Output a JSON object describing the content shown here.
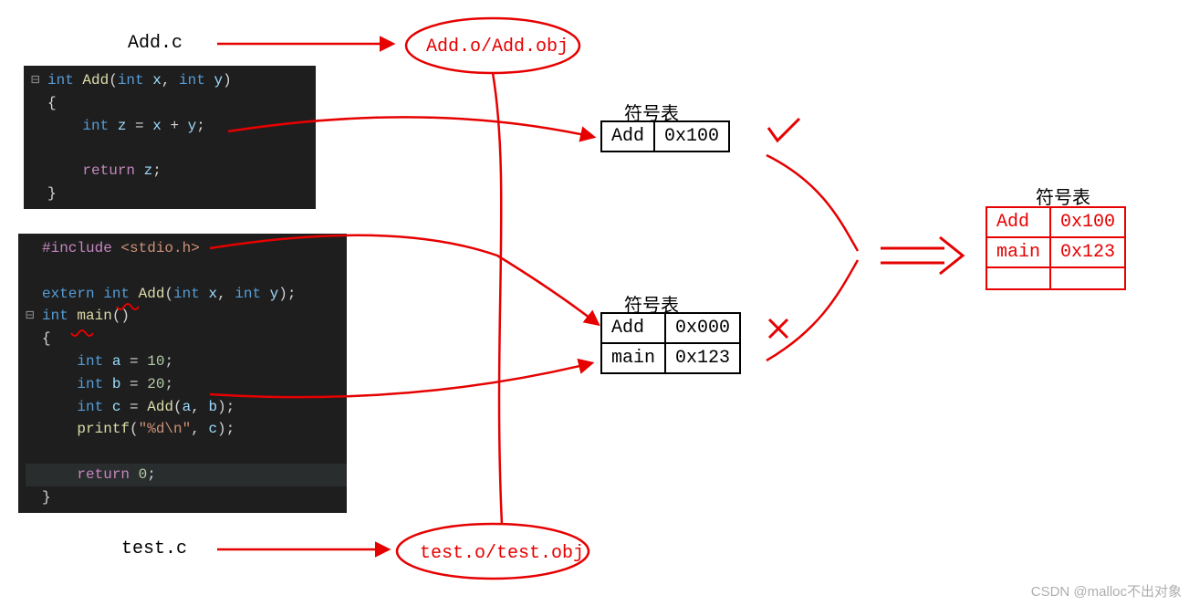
{
  "labels": {
    "add_c": "Add.c",
    "test_c": "test.c",
    "add_obj": "Add.o/Add.obj",
    "test_obj": "test.o/test.obj"
  },
  "sym_title": "符号表",
  "tables": {
    "add": {
      "rows": [
        [
          "Add",
          "0x100"
        ]
      ]
    },
    "test": {
      "rows": [
        [
          "Add",
          "0x000"
        ],
        [
          "main",
          "0x123"
        ]
      ]
    },
    "merged": {
      "rows": [
        [
          "Add",
          "0x100"
        ],
        [
          "main",
          "0x123"
        ]
      ]
    }
  },
  "code_add": {
    "lines": [
      {
        "fold": "⊟",
        "tok": [
          [
            "kw-blue",
            "int "
          ],
          [
            "kw-yellow",
            "Add"
          ],
          [
            "kw-white",
            "("
          ],
          [
            "kw-blue",
            "int "
          ],
          [
            "kw-grey",
            "x"
          ],
          [
            "kw-white",
            ", "
          ],
          [
            "kw-blue",
            "int "
          ],
          [
            "kw-grey",
            "y"
          ],
          [
            "kw-white",
            ")"
          ]
        ]
      },
      {
        "fold": " ",
        "tok": [
          [
            "kw-white",
            "{"
          ]
        ]
      },
      {
        "fold": " ",
        "tok": [
          [
            "kw-white",
            "    "
          ],
          [
            "kw-blue",
            "int "
          ],
          [
            "kw-grey",
            "z"
          ],
          [
            "kw-white",
            " = "
          ],
          [
            "kw-grey",
            "x"
          ],
          [
            "kw-white",
            " + "
          ],
          [
            "kw-grey",
            "y"
          ],
          [
            "kw-white",
            ";"
          ]
        ]
      },
      {
        "fold": " ",
        "tok": [
          [
            "kw-white",
            ""
          ]
        ]
      },
      {
        "fold": " ",
        "tok": [
          [
            "kw-white",
            "    "
          ],
          [
            "kw-purple",
            "return "
          ],
          [
            "kw-grey",
            "z"
          ],
          [
            "kw-white",
            ";"
          ]
        ]
      },
      {
        "fold": " ",
        "tok": [
          [
            "kw-white",
            "}"
          ]
        ]
      }
    ]
  },
  "code_test": {
    "lines": [
      {
        "fold": " ",
        "tok": [
          [
            "kw-purple",
            "#include "
          ],
          [
            "kw-str",
            "<stdio.h>"
          ]
        ]
      },
      {
        "fold": " ",
        "tok": [
          [
            "kw-white",
            ""
          ]
        ]
      },
      {
        "fold": " ",
        "tok": [
          [
            "kw-blue",
            "extern int "
          ],
          [
            "kw-yellow",
            "Add"
          ],
          [
            "kw-white",
            "("
          ],
          [
            "kw-blue",
            "int "
          ],
          [
            "kw-grey",
            "x"
          ],
          [
            "kw-white",
            ", "
          ],
          [
            "kw-blue",
            "int "
          ],
          [
            "kw-grey",
            "y"
          ],
          [
            "kw-white",
            ");"
          ]
        ]
      },
      {
        "fold": "⊟",
        "tok": [
          [
            "kw-blue",
            "int "
          ],
          [
            "kw-yellow",
            "main"
          ],
          [
            "kw-white",
            "()"
          ]
        ]
      },
      {
        "fold": " ",
        "tok": [
          [
            "kw-white",
            "{"
          ]
        ]
      },
      {
        "fold": " ",
        "tok": [
          [
            "kw-white",
            "    "
          ],
          [
            "kw-blue",
            "int "
          ],
          [
            "kw-grey",
            "a"
          ],
          [
            "kw-white",
            " = "
          ],
          [
            "kw-num",
            "10"
          ],
          [
            "kw-white",
            ";"
          ]
        ]
      },
      {
        "fold": " ",
        "tok": [
          [
            "kw-white",
            "    "
          ],
          [
            "kw-blue",
            "int "
          ],
          [
            "kw-grey",
            "b"
          ],
          [
            "kw-white",
            " = "
          ],
          [
            "kw-num",
            "20"
          ],
          [
            "kw-white",
            ";"
          ]
        ]
      },
      {
        "fold": " ",
        "tok": [
          [
            "kw-white",
            "    "
          ],
          [
            "kw-blue",
            "int "
          ],
          [
            "kw-grey",
            "c"
          ],
          [
            "kw-white",
            " = "
          ],
          [
            "kw-yellow",
            "Add"
          ],
          [
            "kw-white",
            "("
          ],
          [
            "kw-grey",
            "a"
          ],
          [
            "kw-white",
            ", "
          ],
          [
            "kw-grey",
            "b"
          ],
          [
            "kw-white",
            ");"
          ]
        ]
      },
      {
        "fold": " ",
        "tok": [
          [
            "kw-white",
            "    "
          ],
          [
            "kw-yellow",
            "printf"
          ],
          [
            "kw-white",
            "("
          ],
          [
            "kw-str",
            "\"%d\\n\""
          ],
          [
            "kw-white",
            ", "
          ],
          [
            "kw-grey",
            "c"
          ],
          [
            "kw-white",
            ");"
          ]
        ]
      },
      {
        "fold": " ",
        "tok": [
          [
            "kw-white",
            ""
          ]
        ]
      },
      {
        "fold": " ",
        "hl": true,
        "tok": [
          [
            "kw-white",
            "    "
          ],
          [
            "kw-purple",
            "return "
          ],
          [
            "kw-num",
            "0"
          ],
          [
            "kw-white",
            ";"
          ]
        ]
      },
      {
        "fold": " ",
        "tok": [
          [
            "kw-white",
            "}"
          ]
        ]
      }
    ]
  },
  "watermark": "CSDN @malloc不出对象"
}
